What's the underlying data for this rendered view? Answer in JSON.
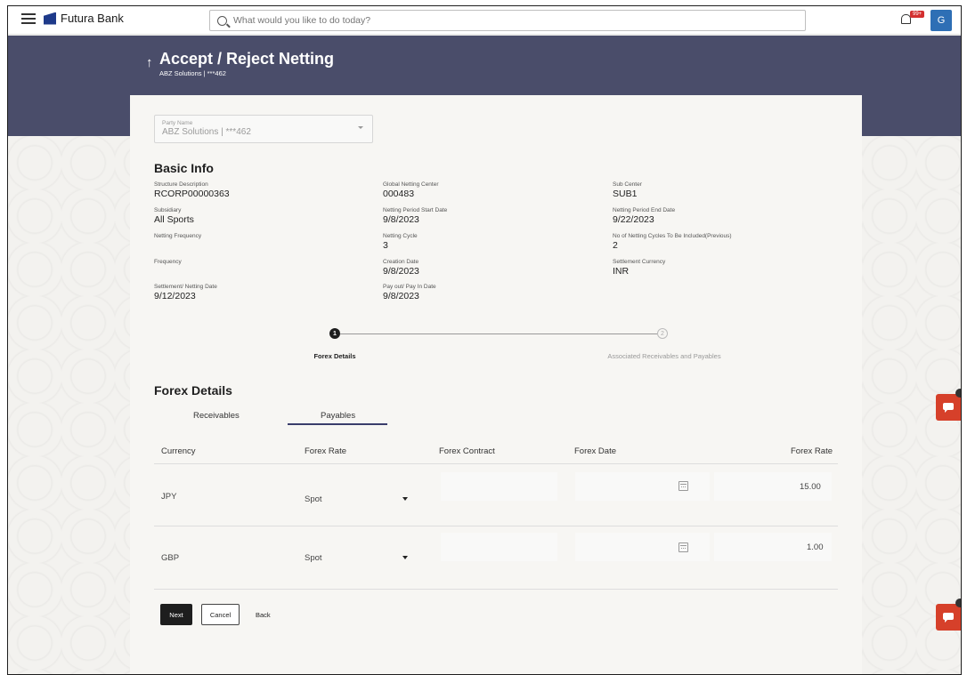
{
  "topbar": {
    "brand": "Futura Bank",
    "search_placeholder": "What would you like to do today?",
    "notification_badge": "99+",
    "avatar_initial": "G"
  },
  "header": {
    "title": "Accept / Reject Netting",
    "subtitle": "ABZ Solutions | ***462"
  },
  "party": {
    "label": "Party Name",
    "value": "ABZ Solutions | ***462"
  },
  "basic_info": {
    "title": "Basic Info",
    "fields": [
      {
        "label": "Structure Description",
        "value": "RCORP00000363"
      },
      {
        "label": "Global Netting Center",
        "value": "000483"
      },
      {
        "label": "Sub Center",
        "value": "SUB1"
      },
      {
        "label": "Subsidiary",
        "value": "All Sports"
      },
      {
        "label": "Netting Period Start Date",
        "value": "9/8/2023"
      },
      {
        "label": "Netting Period End Date",
        "value": "9/22/2023"
      },
      {
        "label": "Netting Frequency",
        "value": ""
      },
      {
        "label": "Netting Cycle",
        "value": "3"
      },
      {
        "label": "No of Netting Cycles To Be Included(Previous)",
        "value": "2"
      },
      {
        "label": "Frequency",
        "value": ""
      },
      {
        "label": "Creation Date",
        "value": "9/8/2023"
      },
      {
        "label": "Settlement Currency",
        "value": "INR"
      },
      {
        "label": "Settlement/ Netting Date",
        "value": "9/12/2023"
      },
      {
        "label": "Pay out/ Pay In Date",
        "value": "9/8/2023"
      }
    ]
  },
  "stepper": {
    "step1_number": "1",
    "step1_label": "Forex Details",
    "step2_number": "2",
    "step2_label": "Associated Receivables and Payables"
  },
  "forex": {
    "title": "Forex Details",
    "tabs": [
      "Receivables",
      "Payables"
    ],
    "active_tab": "Payables",
    "columns": [
      "Currency",
      "Forex Rate",
      "Forex Contract",
      "Forex Date",
      "Forex Rate"
    ],
    "rows": [
      {
        "currency": "JPY",
        "rate_type": "Spot",
        "contract": "",
        "date": "",
        "rate": "15.00"
      },
      {
        "currency": "GBP",
        "rate_type": "Spot",
        "contract": "",
        "date": "",
        "rate": "1.00"
      }
    ]
  },
  "actions": {
    "next": "Next",
    "cancel": "Cancel",
    "back": "Back"
  }
}
